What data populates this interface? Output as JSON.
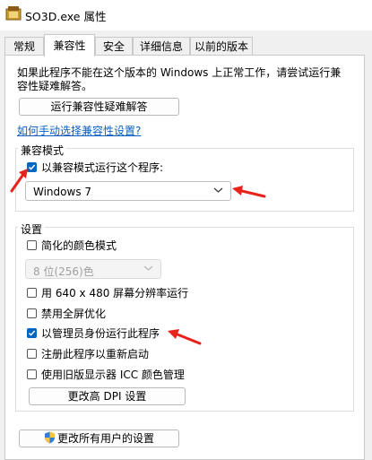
{
  "window": {
    "title": "SO3D.exe 属性",
    "icon": "program-icon"
  },
  "tabs": [
    {
      "label": "常规"
    },
    {
      "label": "兼容性",
      "active": true
    },
    {
      "label": "安全"
    },
    {
      "label": "详细信息"
    },
    {
      "label": "以前的版本"
    }
  ],
  "compat": {
    "intro": "如果此程序不能在这个版本的 Windows 上正常工作，请尝试运行兼容性疑难解答。",
    "troubleshoot_button": "运行兼容性疑难解答",
    "manual_link": "如何手动选择兼容性设置?",
    "mode_group": {
      "label": "兼容模式",
      "checkbox_label": "以兼容模式运行这个程序:",
      "checked": true,
      "os_select_value": "Windows 7"
    },
    "settings_group": {
      "label": "设置",
      "reduced_color": {
        "label": "简化的颜色模式",
        "checked": false
      },
      "color_select_value": "8 位(256)色",
      "low_res": {
        "label": "用 640 x 480 屏幕分辨率运行",
        "checked": false
      },
      "disable_fullscreen": {
        "label": "禁用全屏优化",
        "checked": false
      },
      "run_as_admin": {
        "label": "以管理员身份运行此程序",
        "checked": true
      },
      "register_restart": {
        "label": "注册此程序以重新启动",
        "checked": false
      },
      "legacy_icc": {
        "label": "使用旧版显示器 ICC 颜色管理",
        "checked": false
      },
      "dpi_button": "更改高 DPI 设置"
    },
    "all_users_button": "更改所有用户的设置"
  },
  "colors": {
    "accent": "#0067c0",
    "annotation_arrow": "#e8231c",
    "link": "#0b5fc2"
  }
}
